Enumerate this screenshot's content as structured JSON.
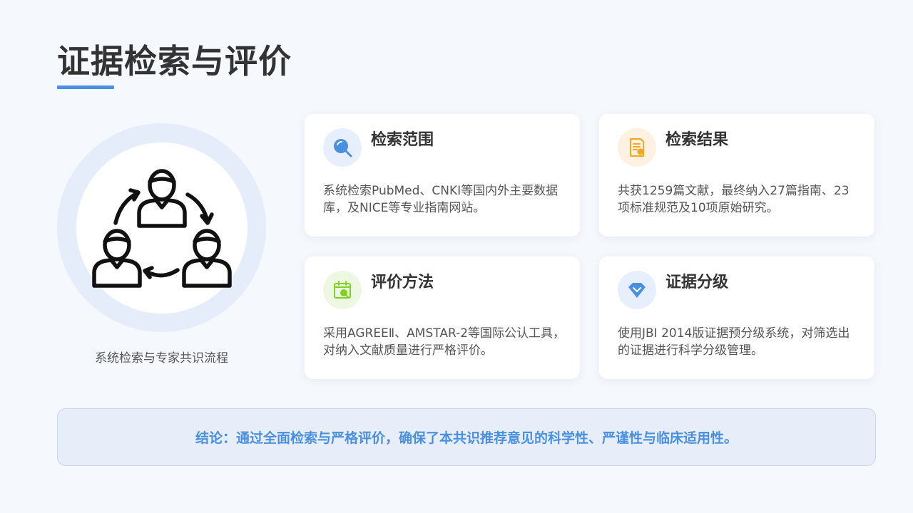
{
  "page": {
    "title": "证据检索与评价"
  },
  "illustration": {
    "caption": "系统检索与专家共识流程",
    "icon": "team-cycle-icon"
  },
  "cards": [
    {
      "title": "检索范围",
      "icon": "search-icon",
      "body": "系统检索PubMed、CNKI等国内外主要数据库，及NICE等专业指南网站。"
    },
    {
      "title": "检索结果",
      "icon": "document-icon",
      "body": "共获1259篇文献，最终纳入27篇指南、23项标准规范及10项原始研究。"
    },
    {
      "title": "评价方法",
      "icon": "calendar-check-icon",
      "body": "采用AGREEⅡ、AMSTAR-2等国际公认工具，对纳入文献质量进行严格评价。"
    },
    {
      "title": "证据分级",
      "icon": "diamond-icon",
      "body": "使用JBI 2014版证据预分级系统，对筛选出的证据进行科学分级管理。"
    }
  ],
  "conclusion": {
    "text": "结论：通过全面检索与严格评价，确保了本共识推荐意见的科学性、严谨性与临床适用性。"
  },
  "colors": {
    "accent": "#4a90e2",
    "orange": "#f5a623",
    "green": "#7ed321",
    "background": "#f5f8fc"
  }
}
